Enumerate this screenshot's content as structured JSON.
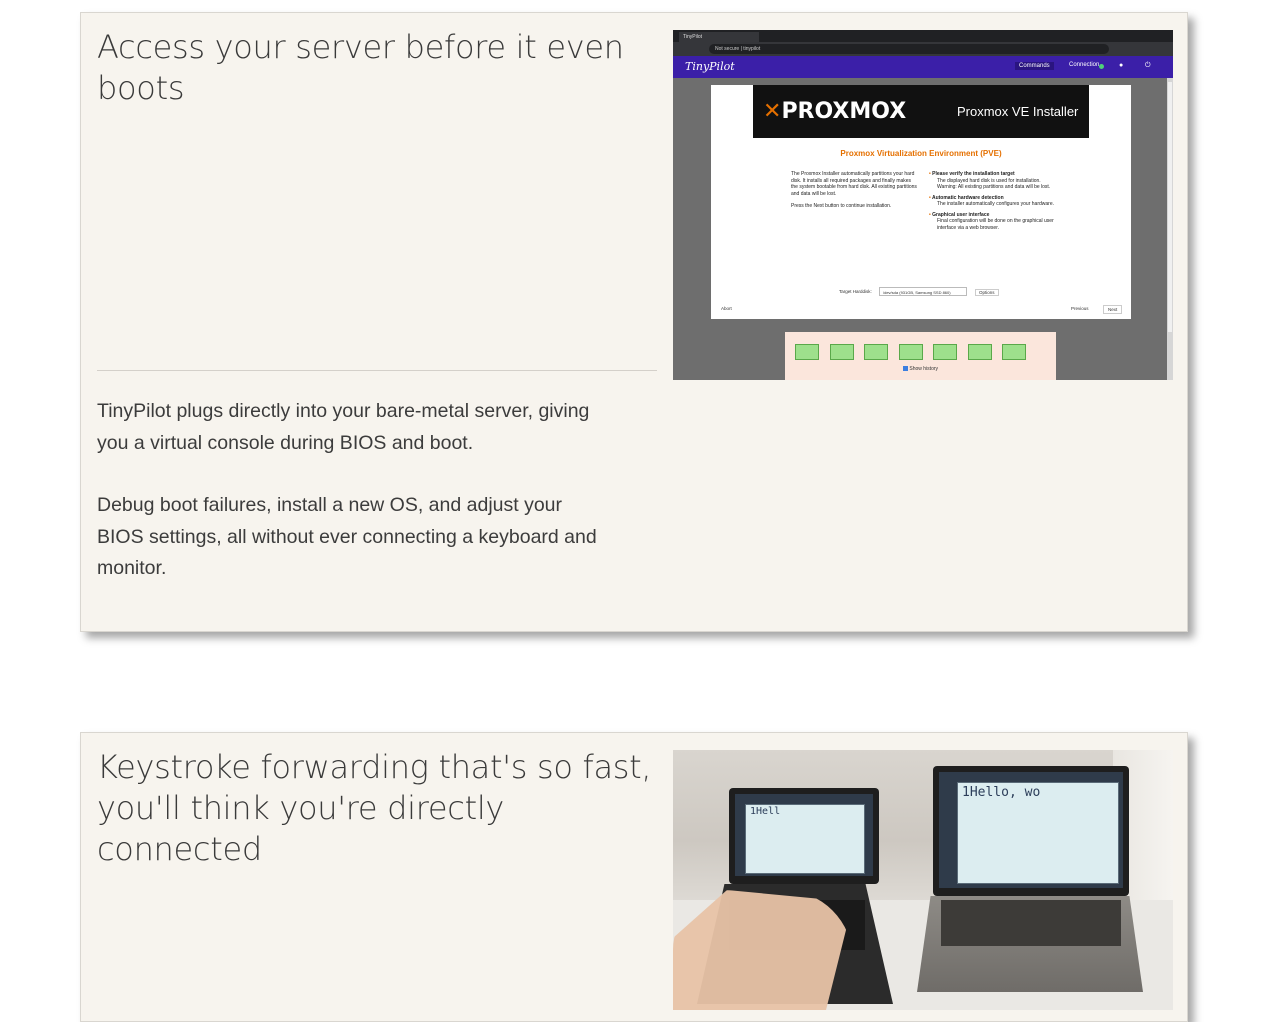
{
  "sections": [
    {
      "heading": "Access your server before it even boots",
      "paragraphs": [
        "TinyPilot plugs directly into your bare-metal server, giving you a virtual console during BIOS and boot.",
        "Debug boot failures, install a new OS, and adjust your BIOS settings, all without ever connecting a keyboard and monitor."
      ],
      "screenshot": {
        "browser_tab": "TinyPilot",
        "address": "Not secure | tinypilot",
        "app_logo": "TinyPilot",
        "menu_commands": "Commands",
        "menu_connection": "Connection",
        "installer": {
          "brand": "PROXMOX",
          "title": "Proxmox VE Installer",
          "heading": "Proxmox Virtualization Environment (PVE)",
          "left_text": "The Proxmox Installer automatically partitions your hard disk. It installs all required packages and finally makes the system bootable from hard disk. All existing partitions and data will be lost.",
          "left_text2": "Press the Next button to continue installation.",
          "right_items": [
            {
              "title": "Please verify the installation target",
              "body": "The displayed hard disk is used for installation. Warning: All existing partitions and data will be lost."
            },
            {
              "title": "Automatic hardware detection",
              "body": "The installer automatically configures your hardware."
            },
            {
              "title": "Graphical user interface",
              "body": "Final configuration will be done on the graphical user interface via a web browser."
            }
          ],
          "target_label": "Target Harddisk:",
          "target_value": "/dev/sda (931GB, Samsung SSD 860)",
          "options_label": "Options",
          "abort_label": "Abort",
          "previous_label": "Previous",
          "next_label": "Next"
        },
        "history_label": "Show history"
      }
    },
    {
      "heading": "Keystroke forwarding that's so fast, you'll think you're directly connected",
      "photo": {
        "typed_left": "1Hell",
        "typed_right": "1Hello, wo"
      }
    }
  ]
}
